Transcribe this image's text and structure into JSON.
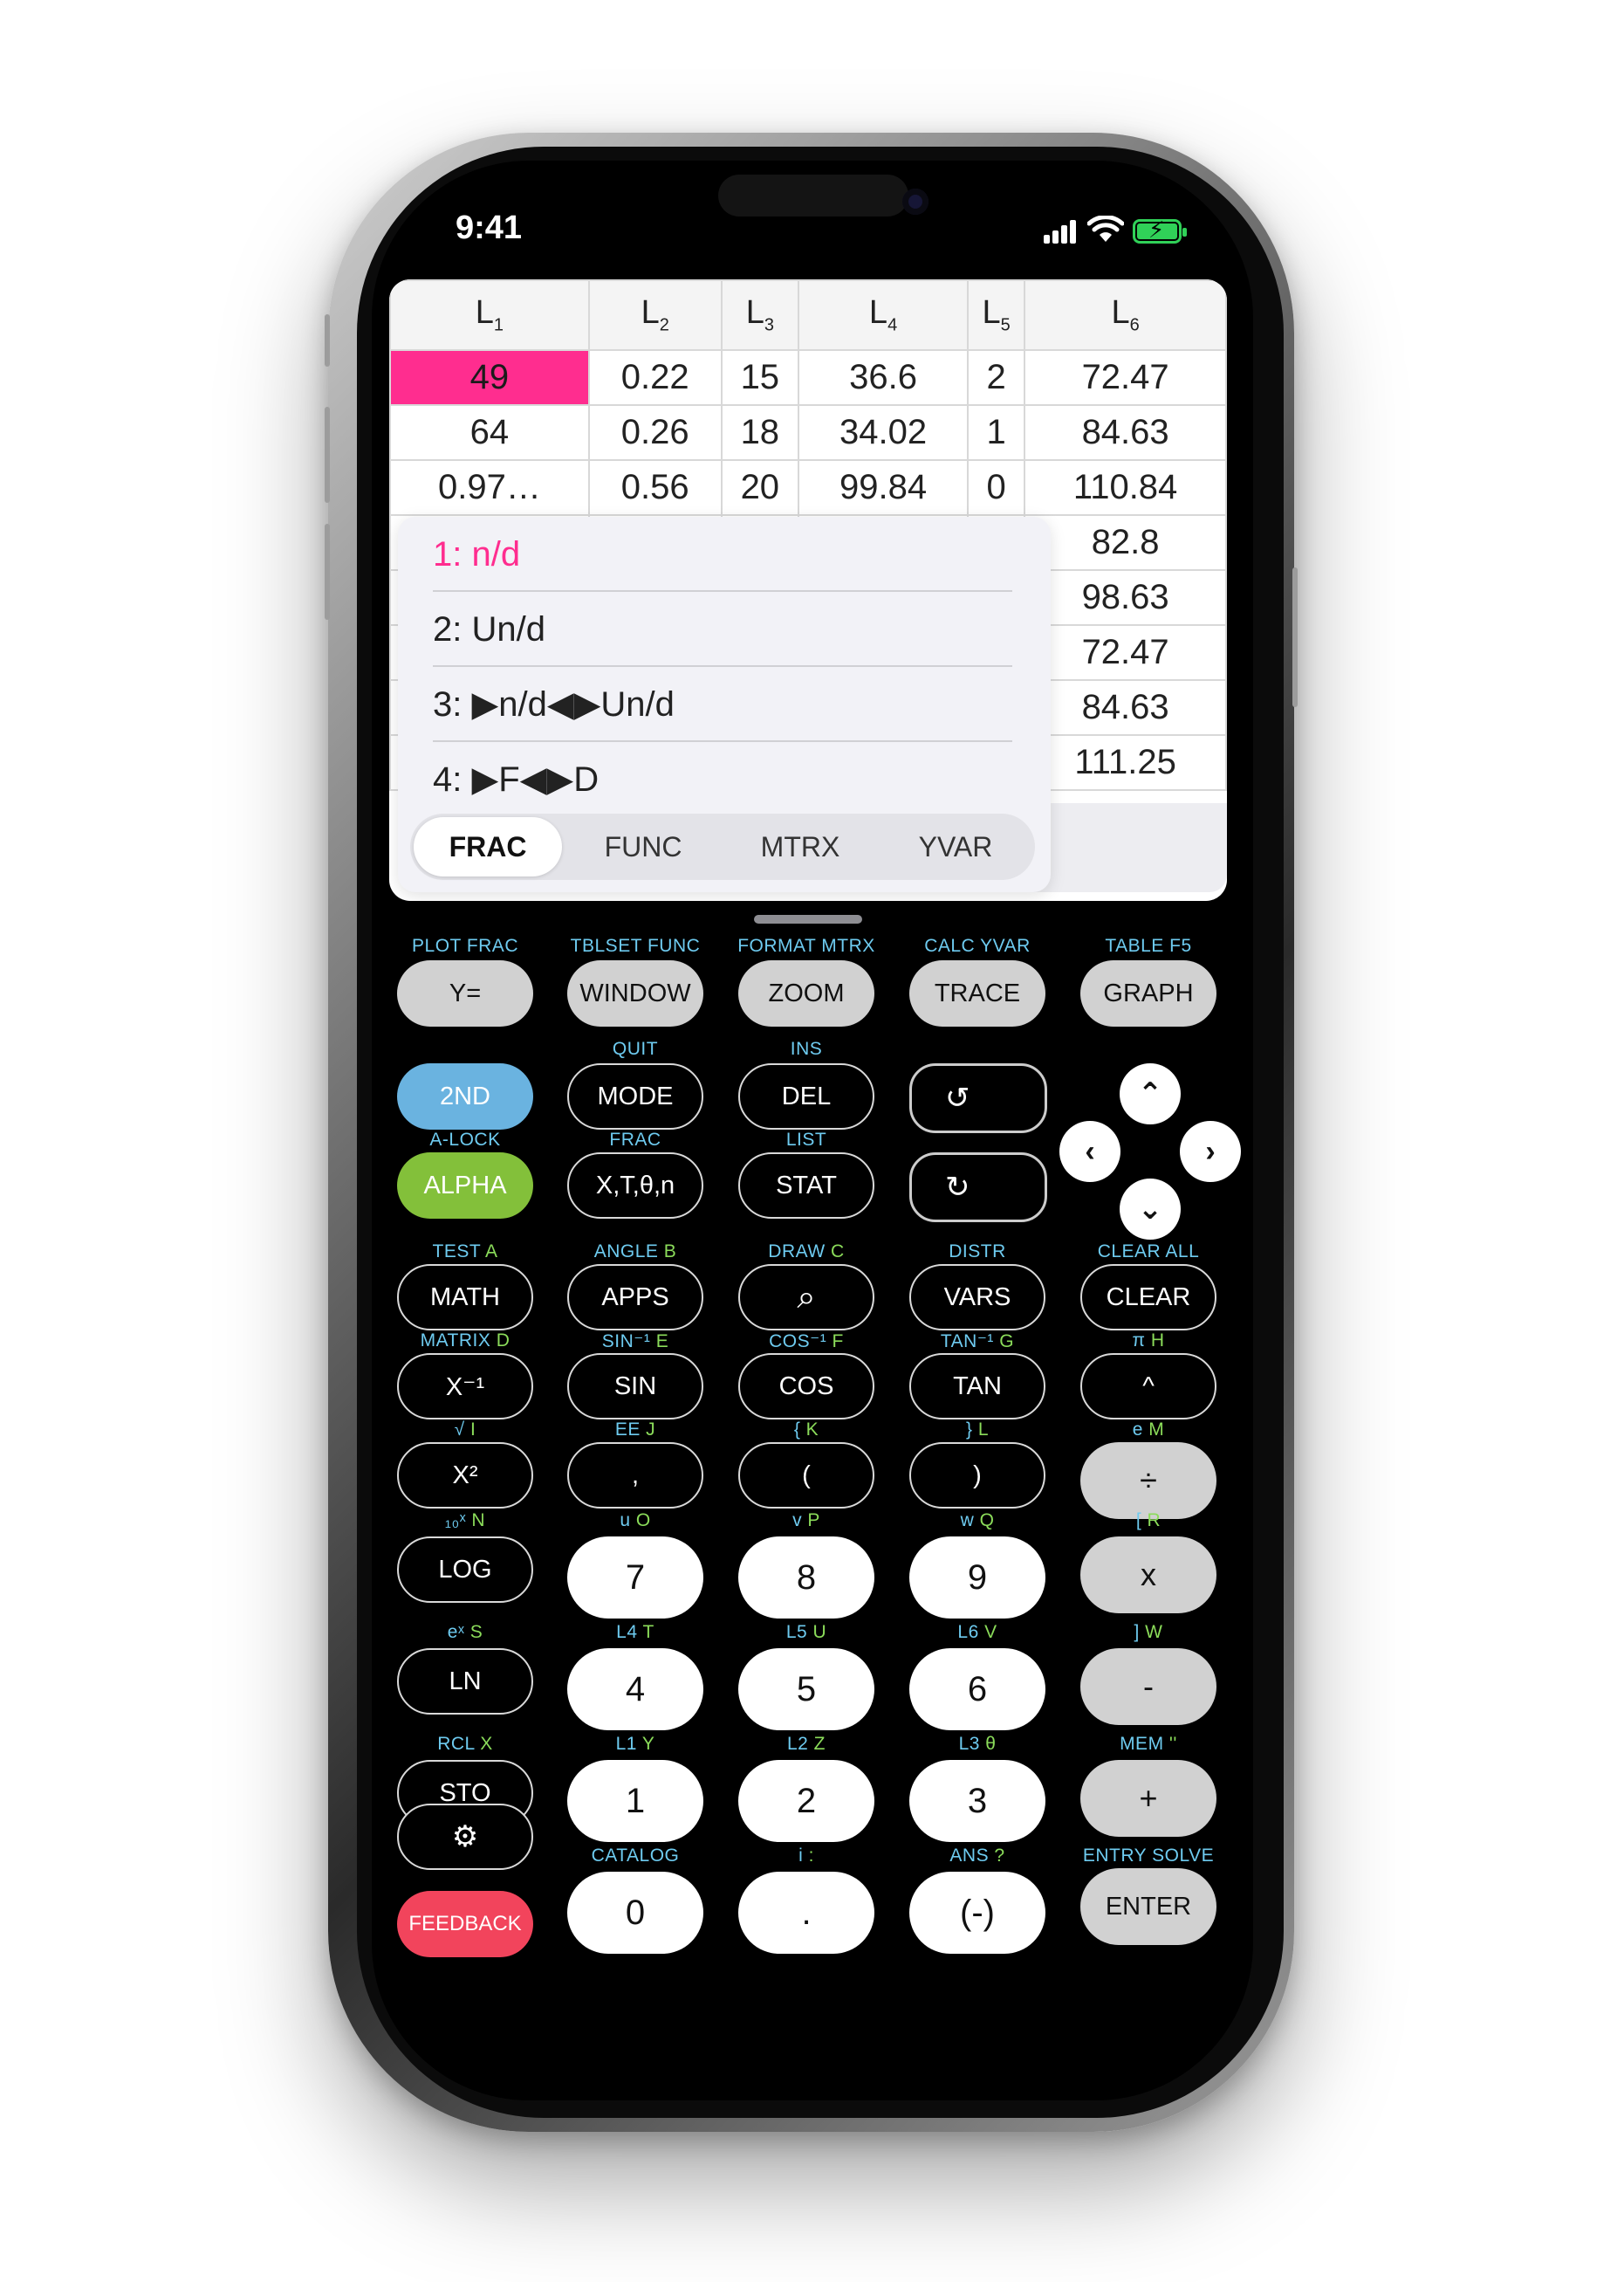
{
  "status_bar": {
    "time": "9:41"
  },
  "table": {
    "headers": [
      {
        "base": "L",
        "sub": "1"
      },
      {
        "base": "L",
        "sub": "2"
      },
      {
        "base": "L",
        "sub": "3"
      },
      {
        "base": "L",
        "sub": "4"
      },
      {
        "base": "L",
        "sub": "5"
      },
      {
        "base": "L",
        "sub": "6"
      }
    ],
    "rows": [
      [
        "49",
        "0.22",
        "15",
        "36.6",
        "2",
        "72.47"
      ],
      [
        "64",
        "0.26",
        "18",
        "34.02",
        "1",
        "84.63"
      ],
      [
        "0.97…",
        "0.56",
        "20",
        "99.84",
        "0",
        "110.84"
      ],
      [
        "",
        "",
        "",
        "",
        "",
        "82.8"
      ],
      [
        "",
        "",
        "",
        "",
        "",
        "98.63"
      ],
      [
        "",
        "",
        "",
        "",
        "",
        "72.47"
      ],
      [
        "",
        "",
        "",
        "",
        "",
        "84.63"
      ],
      [
        "",
        "",
        "",
        "",
        "",
        "111.25"
      ]
    ]
  },
  "menu": {
    "items": [
      "1: n/d",
      "2: Un/d",
      "3: ▶n/d◀▶Un/d",
      "4: ▶F◀▶D"
    ],
    "tabs": [
      "FRAC",
      "FUNC",
      "MTRX",
      "YVAR"
    ],
    "active_tab": "FRAC"
  },
  "keypad": {
    "row_top": {
      "labels": [
        "PLOT FRAC",
        "TBLSET FUNC",
        "FORMAT MTRX",
        "CALC YVAR",
        "TABLE   F5"
      ],
      "keys": [
        "Y=",
        "WINDOW",
        "ZOOM",
        "TRACE",
        "GRAPH"
      ]
    },
    "row2": {
      "labels": [
        "QUIT",
        "INS"
      ],
      "keys": [
        "2ND",
        "MODE",
        "DEL"
      ]
    },
    "row3": {
      "labels": [
        "A-LOCK",
        "FRAC",
        "LIST"
      ],
      "keys": [
        "ALPHA",
        "X,T,θ,n",
        "STAT"
      ]
    },
    "undo_icon": "↺",
    "redo_icon": "↻",
    "arrows": {
      "up": "⌃",
      "down": "⌄",
      "left": "‹",
      "right": "›"
    },
    "row4": {
      "labels": [
        [
          "TEST",
          "A"
        ],
        [
          "ANGLE",
          "B"
        ],
        [
          "DRAW",
          "C"
        ],
        [
          "DISTR",
          ""
        ],
        [
          "CLEAR ALL",
          ""
        ]
      ],
      "keys": [
        "MATH",
        "APPS",
        "search-icon",
        "VARS",
        "CLEAR"
      ]
    },
    "row5": {
      "labels": [
        [
          "MATRIX",
          "D"
        ],
        [
          "SIN⁻¹",
          "E"
        ],
        [
          "COS⁻¹",
          "F"
        ],
        [
          "TAN⁻¹",
          "G"
        ],
        [
          "π",
          "H"
        ]
      ],
      "keys": [
        "X⁻¹",
        "SIN",
        "COS",
        "TAN",
        "^"
      ]
    },
    "row6": {
      "labels": [
        [
          "√",
          "I"
        ],
        [
          "EE",
          "J"
        ],
        [
          "{",
          "K"
        ],
        [
          "}",
          "L"
        ],
        [
          "e",
          "M"
        ]
      ],
      "keys": [
        "X²",
        ",",
        "(",
        ")",
        "÷"
      ]
    },
    "row7": {
      "labels": [
        [
          "₁₀ˣ",
          "N"
        ],
        [
          "u",
          "O"
        ],
        [
          "v",
          "P"
        ],
        [
          "w",
          "Q"
        ],
        [
          "[",
          "R"
        ]
      ],
      "keys": [
        "LOG",
        "7",
        "8",
        "9",
        "x"
      ]
    },
    "row8": {
      "labels": [
        [
          "eˣ",
          "S"
        ],
        [
          "L4",
          "T"
        ],
        [
          "L5",
          "U"
        ],
        [
          "L6",
          "V"
        ],
        [
          "]",
          "W"
        ]
      ],
      "keys": [
        "LN",
        "4",
        "5",
        "6",
        "-"
      ]
    },
    "row9": {
      "labels": [
        [
          "RCL",
          "X"
        ],
        [
          "L1",
          "Y"
        ],
        [
          "L2",
          "Z"
        ],
        [
          "L3",
          "θ"
        ],
        [
          "MEM",
          "''"
        ]
      ],
      "keys": [
        "STO",
        "1",
        "2",
        "3",
        "+"
      ]
    },
    "row10": {
      "labels": [
        [
          "",
          ""
        ],
        [
          "CATALOG",
          ""
        ],
        [
          "i",
          ":"
        ],
        [
          "ANS",
          "?"
        ],
        [
          "ENTRY SOLVE",
          ""
        ]
      ],
      "keys": [
        "gear-icon",
        "",
        "",
        "",
        ""
      ]
    },
    "row11": {
      "keys": [
        "FEEDBACK",
        "0",
        ".",
        "(-)",
        "ENTER"
      ]
    }
  },
  "colors": {
    "highlight": "#ff2d8f",
    "second": "#6ab3e0",
    "alpha": "#83c03a",
    "feedback": "#f2445c",
    "label_blue": "#6ecbf0",
    "label_green": "#8bdc5a"
  }
}
